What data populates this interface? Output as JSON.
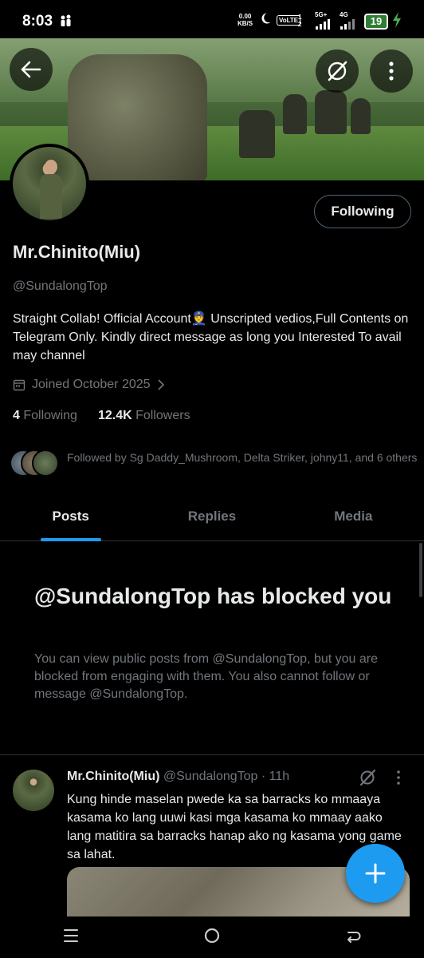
{
  "status_bar": {
    "time": "8:03",
    "speed_value": "0.00",
    "speed_unit": "KB/S",
    "volte": "VoLTE",
    "sim_1": "1",
    "sim_2": "2",
    "network_1": "5G+",
    "network_2": "4G",
    "battery": "19"
  },
  "profile": {
    "display_name": "Mr.Chinito(Miu)",
    "handle": "@SundalongTop",
    "bio": "Straight Collab! Official Account👮 Unscripted vedios,Full Contents on Telegram Only. Kindly direct message as long you Interested To avail may channel",
    "joined": "Joined October 2025",
    "following_count": "4",
    "following_label": "Following",
    "followers_count": "12.4K",
    "followers_label": "Followers",
    "followed_by": "Followed by Sg Daddy_Mushroom, Delta Striker, johny11, and 6 others",
    "following_button": "Following"
  },
  "tabs": [
    {
      "label": "Posts",
      "active": true
    },
    {
      "label": "Replies",
      "active": false
    },
    {
      "label": "Media",
      "active": false
    }
  ],
  "blocked": {
    "title": "@SundalongTop has blocked you",
    "text": "You can view public posts from @SundalongTop, but you are blocked from engaging with them. You also cannot follow or message @SundalongTop."
  },
  "tweet": {
    "name": "Mr.Chinito(Miu)",
    "handle": "@SundalongTop",
    "separator": "·",
    "time": "11h",
    "text": "Kung hinde maselan pwede ka sa barracks ko mmaaya kasama ko lang uuwi kasi mga kasama ko mmaay aako lang matitira sa barracks hanap ako ng kasama yong game sa lahat."
  },
  "colors": {
    "accent": "#1d9bf0",
    "background": "#000000",
    "text_primary": "#e7e9ea",
    "text_secondary": "#71767b"
  },
  "icons": {
    "back": "arrow-left-icon",
    "grok": "grok-icon",
    "more": "more-vertical-icon",
    "calendar": "calendar-icon",
    "chevron": "chevron-right-icon",
    "compose": "plus-icon",
    "nav_recents": "recents-icon",
    "nav_home": "home-circle-icon",
    "nav_back": "back-icon"
  }
}
